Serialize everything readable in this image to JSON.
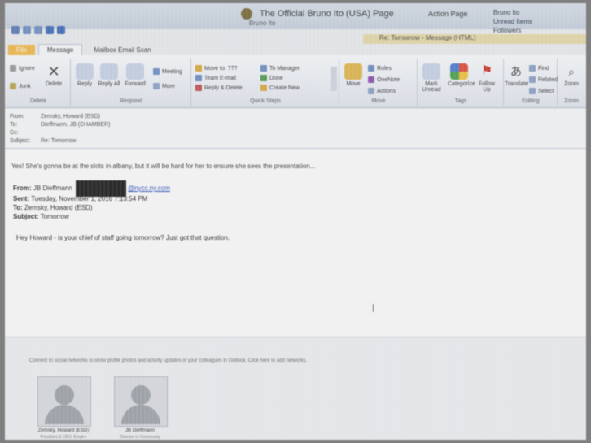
{
  "window": {
    "title": "The Official Bruno Ito (USA) Page",
    "subtitle": "Bruno Ito",
    "right_label": "Action Page",
    "account_lines": [
      "Bruno Ito",
      "Unread Items",
      "Followers"
    ],
    "context_tab": "Re: Tomorrow - Message (HTML)",
    "colors": {
      "file_tab": "#f0b84a",
      "ribbon": "#dfe4ec",
      "accent": "#2a4fc0"
    }
  },
  "tabs": {
    "file": "File",
    "message": "Message",
    "mailbox": "Mailbox Email Scan"
  },
  "ribbon": {
    "delete_group": {
      "label": "Delete",
      "ignore": "Ignore",
      "junk": "Junk",
      "delete": "Delete"
    },
    "respond_group": {
      "label": "Respond",
      "reply": "Reply",
      "reply_all": "Reply All",
      "forward": "Forward",
      "meeting": "Meeting",
      "more": "More"
    },
    "quick_steps": {
      "label": "Quick Steps",
      "items": [
        "Move to: ???",
        "To Manager",
        "Team E-mail",
        "Done",
        "Reply & Delete",
        "Create New"
      ]
    },
    "move_group": {
      "label": "Move",
      "move": "Move",
      "rules": "Rules",
      "onenote": "OneNote",
      "actions": "Actions"
    },
    "tags_group": {
      "label": "Tags",
      "mark_unread": "Mark Unread",
      "categorize": "Categorize",
      "follow_up": "Follow Up"
    },
    "editing_group": {
      "label": "Editing",
      "translate": "Translate",
      "find": "Find",
      "related": "Related",
      "select": "Select"
    },
    "zoom_group": {
      "label": "Zoom",
      "zoom": "Zoom"
    }
  },
  "headers": {
    "from_label": "From:",
    "from": "Zemsky, Howard (ESD)",
    "to_label": "To:",
    "to": "Dieffmann, JB (CHAMBER)",
    "cc_label": "Cc:",
    "cc": "",
    "subject_label": "Subject:",
    "subject": "Re: Tomorrow"
  },
  "body": {
    "reply_line": "Yes! She's gonna be at the slots in albany, but it will be hard for her to ensure she sees the presentation...",
    "from_label": "From:",
    "from_name": "JB Dieffmann",
    "from_email": "@nycc.ny.com",
    "sent_label": "Sent:",
    "sent": "Tuesday, November 1, 2016 7:13:54 PM",
    "to_label": "To:",
    "to": "Zemsky, Howard (ESD)",
    "subject_label": "Subject:",
    "subject": "Tomorrow",
    "message": "Hey Howard - is your chief of staff going tomorrow? Just got that question."
  },
  "people_pane": {
    "notice": "Connect to social networks to show profile photos and activity updates of your colleagues in Outlook. Click here to add networks.",
    "people": [
      {
        "name": "Zemsky, Howard (ESD)",
        "detail": "President & CEO, Empire"
      },
      {
        "name": "JB Dieffmann",
        "detail": "Director of Community"
      }
    ]
  }
}
